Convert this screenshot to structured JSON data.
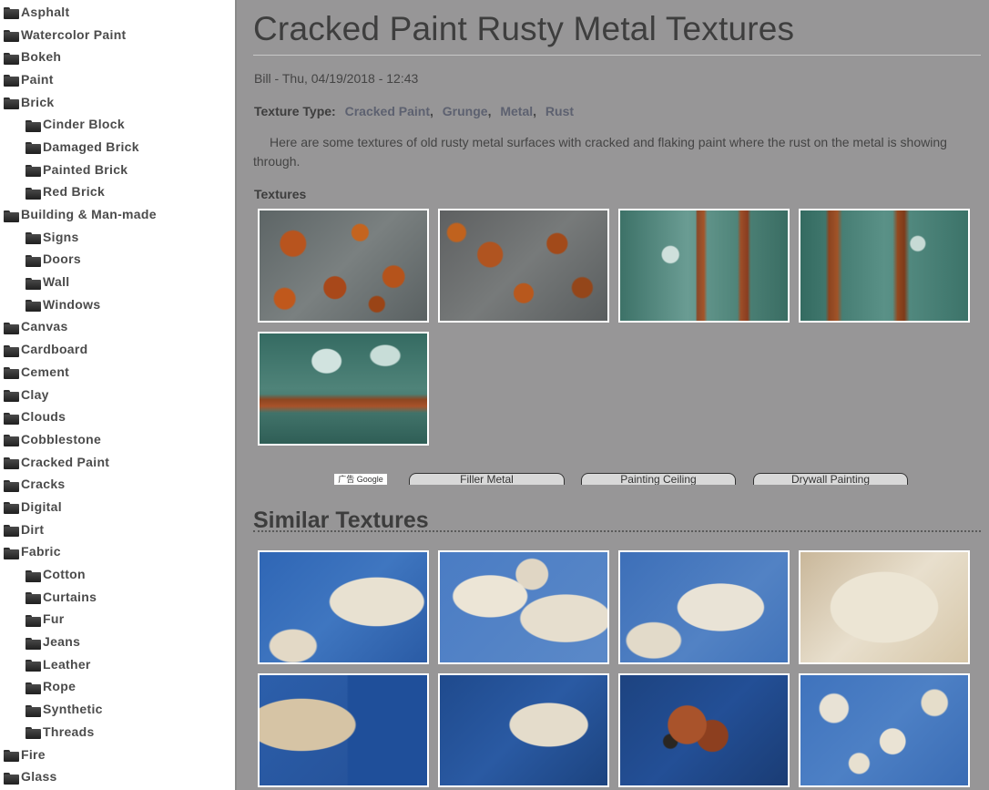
{
  "sidebar": {
    "items": [
      {
        "label": "Asphalt",
        "level": 0
      },
      {
        "label": "Watercolor Paint",
        "level": 0
      },
      {
        "label": "Bokeh",
        "level": 0
      },
      {
        "label": "Paint",
        "level": 0
      },
      {
        "label": "Brick",
        "level": 0
      },
      {
        "label": "Cinder Block",
        "level": 1
      },
      {
        "label": "Damaged Brick",
        "level": 1
      },
      {
        "label": "Painted Brick",
        "level": 1
      },
      {
        "label": "Red Brick",
        "level": 1
      },
      {
        "label": "Building & Man-made",
        "level": 0
      },
      {
        "label": "Signs",
        "level": 1
      },
      {
        "label": "Doors",
        "level": 1
      },
      {
        "label": "Wall",
        "level": 1
      },
      {
        "label": "Windows",
        "level": 1
      },
      {
        "label": "Canvas",
        "level": 0
      },
      {
        "label": "Cardboard",
        "level": 0
      },
      {
        "label": "Cement",
        "level": 0
      },
      {
        "label": "Clay",
        "level": 0
      },
      {
        "label": "Clouds",
        "level": 0
      },
      {
        "label": "Cobblestone",
        "level": 0
      },
      {
        "label": "Cracked Paint",
        "level": 0
      },
      {
        "label": "Cracks",
        "level": 0
      },
      {
        "label": "Digital",
        "level": 0
      },
      {
        "label": "Dirt",
        "level": 0
      },
      {
        "label": "Fabric",
        "level": 0
      },
      {
        "label": "Cotton",
        "level": 1
      },
      {
        "label": "Curtains",
        "level": 1
      },
      {
        "label": "Fur",
        "level": 1
      },
      {
        "label": "Jeans",
        "level": 1
      },
      {
        "label": "Leather",
        "level": 1
      },
      {
        "label": "Rope",
        "level": 1
      },
      {
        "label": "Synthetic",
        "level": 1
      },
      {
        "label": "Threads",
        "level": 1
      },
      {
        "label": "Fire",
        "level": 0
      },
      {
        "label": "Glass",
        "level": 0
      },
      {
        "label": "",
        "level": 1
      }
    ]
  },
  "main": {
    "title": "Cracked Paint Rusty Metal Textures",
    "meta": "Bill - Thu, 04/19/2018 - 12:43",
    "texture_type_label": "Texture Type:",
    "texture_types": [
      "Cracked Paint",
      "Grunge",
      "Metal",
      "Rust"
    ],
    "description": "Here are some textures of old rusty metal surfaces with cracked and flaking paint where the rust on the metal is showing through.",
    "textures_label": "Textures",
    "textures": [
      {
        "name": "texture-thumb-rust-1"
      },
      {
        "name": "texture-thumb-rust-2"
      },
      {
        "name": "texture-thumb-teal-1"
      },
      {
        "name": "texture-thumb-teal-2"
      },
      {
        "name": "texture-thumb-teal-3"
      }
    ],
    "ad": {
      "google_label": "广告 Google",
      "links": [
        "Filler Metal",
        "Painting Ceiling",
        "Drywall Painting"
      ]
    },
    "similar_title": "Similar Textures",
    "similar": [
      {
        "name": "similar-thumb-1"
      },
      {
        "name": "similar-thumb-2"
      },
      {
        "name": "similar-thumb-3"
      },
      {
        "name": "similar-thumb-4"
      },
      {
        "name": "similar-thumb-5"
      },
      {
        "name": "similar-thumb-6"
      },
      {
        "name": "similar-thumb-7"
      },
      {
        "name": "similar-thumb-8"
      }
    ]
  },
  "colors": {
    "page_background": "#979697",
    "sidebar_background": "#ffffff",
    "text": "#3d3d3d",
    "link": "#5d6170"
  },
  "icons": {
    "category": "folder-icon"
  }
}
